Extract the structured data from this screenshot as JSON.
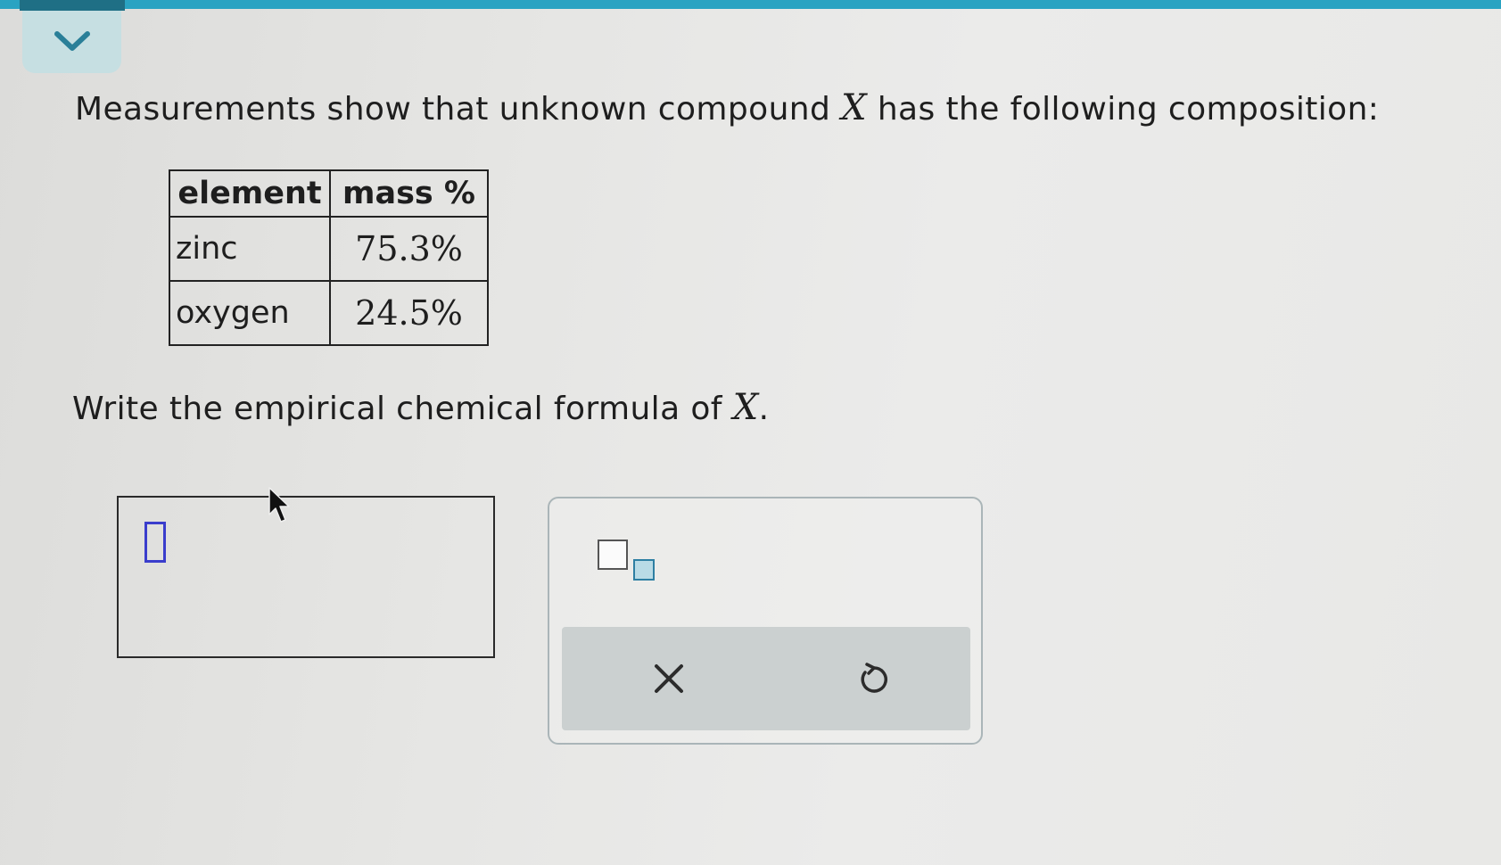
{
  "question": {
    "intro_before_var": "Measurements show that unknown compound ",
    "variable": "X",
    "intro_after_var": " has the following composition:",
    "prompt_before_var": "Write the empirical chemical formula of ",
    "prompt_after_var": "."
  },
  "table": {
    "headers": [
      "element",
      "mass %"
    ],
    "rows": [
      {
        "element": "zinc",
        "mass": "75.3%"
      },
      {
        "element": "oxygen",
        "mass": "24.5%"
      }
    ]
  },
  "icons": {
    "collapse": "chevron-down-icon",
    "subscript": "subscript-icon",
    "clear": "close-icon",
    "undo": "undo-icon",
    "cursor": "mouse-pointer-icon"
  },
  "colors": {
    "accent": "#2aa3c2",
    "accent_dark": "#1f6f85",
    "caret": "#3a3dcc",
    "action_bar": "#cbd0d0"
  }
}
